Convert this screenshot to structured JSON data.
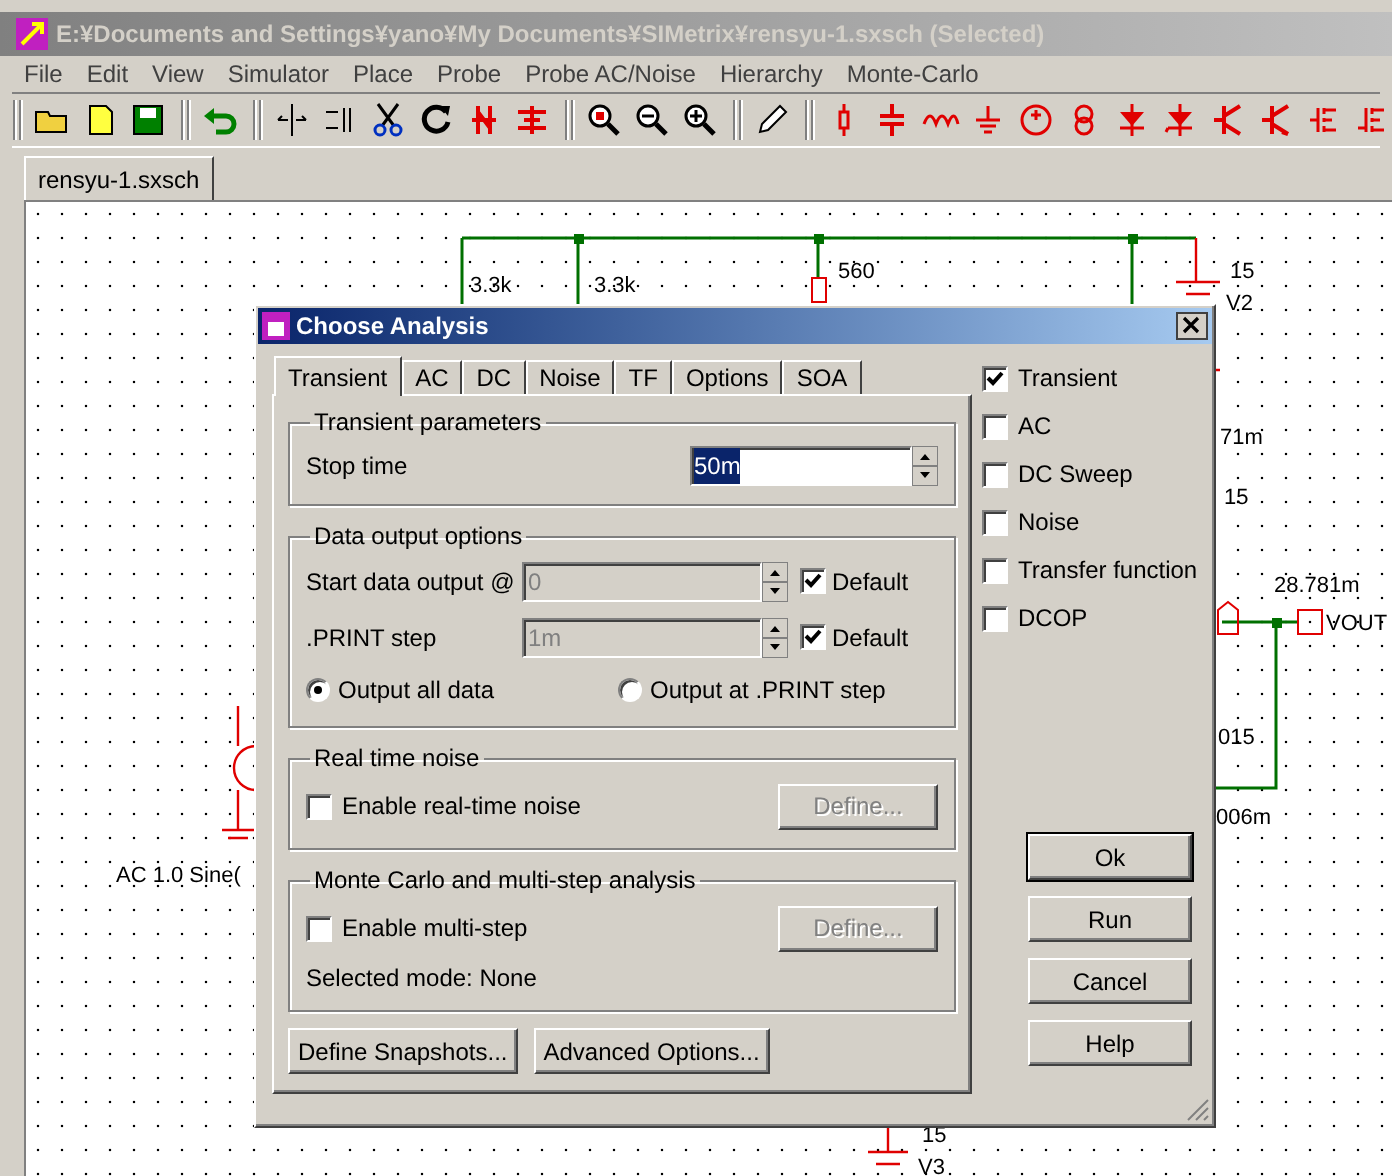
{
  "window": {
    "title": "E:¥Documents and Settings¥yano¥My Documents¥SIMetrix¥rensyu-1.sxsch (Selected)"
  },
  "menu": [
    "File",
    "Edit",
    "View",
    "Simulator",
    "Place",
    "Probe",
    "Probe AC/Noise",
    "Hierarchy",
    "Monte-Carlo"
  ],
  "document_tab": {
    "label": "rensyu-1.sxsch",
    "selected": true
  },
  "schematic": {
    "labels": [
      "3.3k",
      "3.3k",
      "560",
      "15",
      "V2",
      "71m",
      "15",
      "28.781m",
      "VOUT",
      "015",
      "006m",
      "AC 1.0 Sine(",
      "15",
      "V3"
    ]
  },
  "dialog": {
    "title": "Choose Analysis",
    "tabs": [
      {
        "label": "Transient",
        "selected": true
      },
      {
        "label": "AC",
        "selected": false
      },
      {
        "label": "DC",
        "selected": false
      },
      {
        "label": "Noise",
        "selected": false
      },
      {
        "label": "TF",
        "selected": false
      },
      {
        "label": "Options",
        "selected": false
      },
      {
        "label": "SOA",
        "selected": false
      }
    ],
    "transient_parameters": {
      "title": "Transient parameters",
      "label": "Stop time",
      "value": "50m"
    },
    "data_output": {
      "title": "Data output options",
      "fields": [
        {
          "label": "Start data output @",
          "value": "0",
          "disabled": true,
          "default_label": "Default",
          "default_checked": true
        },
        {
          "label": ".PRINT step",
          "value": "1m",
          "disabled": true,
          "default_label": "Default",
          "default_checked": true
        }
      ],
      "radios": [
        {
          "label": "Output all data",
          "selected": true
        },
        {
          "label": "Output at .PRINT step",
          "selected": false
        }
      ]
    },
    "real_time_noise": {
      "title": "Real time noise",
      "checkbox": {
        "label": "Enable real-time noise",
        "checked": false
      },
      "button": {
        "label": "Define...",
        "disabled": true
      }
    },
    "monte_carlo": {
      "title": "Monte Carlo and multi-step analysis",
      "checkbox": {
        "label": "Enable multi-step",
        "checked": false
      },
      "button": {
        "label": "Define...",
        "disabled": true
      },
      "mode": "Selected mode: None"
    },
    "panel_buttons": [
      "Define Snapshots...",
      "Advanced Options..."
    ],
    "analyses": [
      {
        "label": "Transient",
        "checked": true
      },
      {
        "label": "AC",
        "checked": false
      },
      {
        "label": "DC Sweep",
        "checked": false
      },
      {
        "label": "Noise",
        "checked": false
      },
      {
        "label": "Transfer function",
        "checked": false
      },
      {
        "label": "DCOP",
        "checked": false
      }
    ],
    "buttons": [
      "Ok",
      "Run",
      "Cancel",
      "Help"
    ]
  }
}
